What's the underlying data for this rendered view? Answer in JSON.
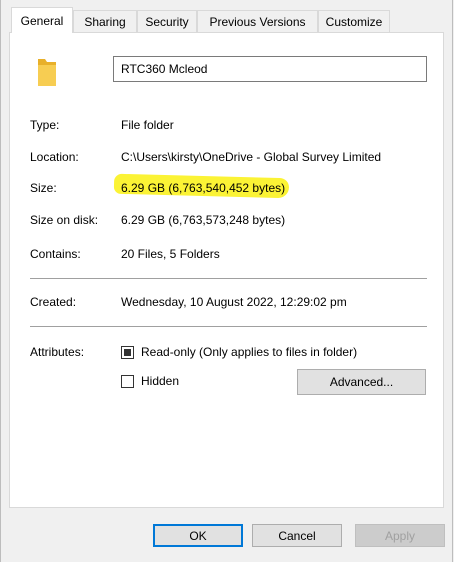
{
  "tabs": [
    {
      "label": "General",
      "active": true
    },
    {
      "label": "Sharing"
    },
    {
      "label": "Security"
    },
    {
      "label": "Previous Versions"
    },
    {
      "label": "Customize"
    }
  ],
  "folder_name": "RTC360 Mcleod",
  "properties": {
    "type_label": "Type:",
    "type_value": "File folder",
    "location_label": "Location:",
    "location_value": "C:\\Users\\kirsty\\OneDrive - Global Survey Limited",
    "size_label": "Size:",
    "size_value": "6.29 GB (6,763,540,452 bytes)",
    "size_on_disk_label": "Size on disk:",
    "size_on_disk_value": "6.29 GB (6,763,573,248 bytes)",
    "contains_label": "Contains:",
    "contains_value": "20 Files, 5 Folders",
    "created_label": "Created:",
    "created_value": "Wednesday, 10 August 2022, 12:29:02 pm"
  },
  "attributes": {
    "label": "Attributes:",
    "readonly_label": "Read-only (Only applies to files in folder)",
    "readonly_state": "indeterminate",
    "hidden_label": "Hidden",
    "hidden_checked": false,
    "advanced_label": "Advanced..."
  },
  "buttons": {
    "ok": "OK",
    "cancel": "Cancel",
    "apply": "Apply"
  },
  "colors": {
    "highlight": "#fbf21f",
    "default_button_border": "#0078d7",
    "folder_icon": "#f0c030"
  }
}
